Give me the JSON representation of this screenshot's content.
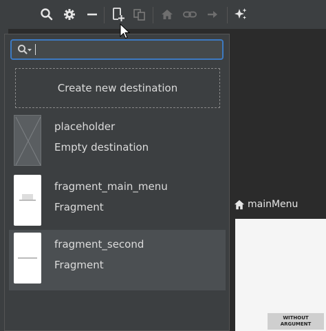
{
  "toolbar": {
    "icons": [
      "search-icon",
      "gear-icon",
      "minus-icon",
      "new-destination-icon",
      "nested-graph-icon",
      "home-icon",
      "link-icon",
      "arrow-right-icon",
      "sparkle-icon"
    ]
  },
  "popup": {
    "search": {
      "value": "",
      "placeholder": ""
    },
    "create_label": "Create new destination",
    "items": [
      {
        "title": "placeholder",
        "subtitle": "Empty destination"
      },
      {
        "title": "fragment_main_menu",
        "subtitle": "Fragment"
      },
      {
        "title": "fragment_second",
        "subtitle": "Fragment"
      }
    ]
  },
  "canvas": {
    "start_label": "mainMenu",
    "button_label": "WITHOUT ARGUMENT"
  },
  "colors": {
    "accent": "#3d7ac2",
    "popup_bg": "#3c3f41",
    "selected": "#4b4f52"
  }
}
